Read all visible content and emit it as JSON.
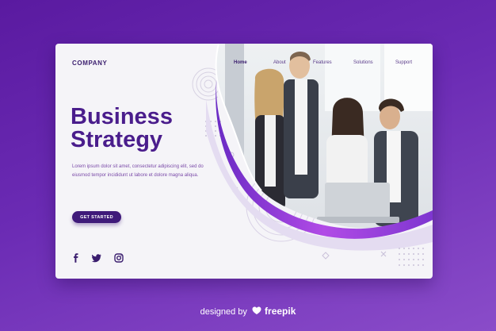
{
  "header": {
    "brand": "COMPANY",
    "nav": [
      {
        "label": "Home",
        "active": true
      },
      {
        "label": "About",
        "active": false
      },
      {
        "label": "Features",
        "active": false
      },
      {
        "label": "Solutions",
        "active": false
      },
      {
        "label": "Support",
        "active": false
      }
    ]
  },
  "hero": {
    "title_line1": "Business",
    "title_line2": "Strategy",
    "body": "Lorem ipsum dolor sit amet, consectetur adipiscing elit, sed do eiusmod tempor incididunt ut labore et dolore magna aliqua.",
    "cta_label": "GET STARTED"
  },
  "social": [
    "facebook-icon",
    "twitter-icon",
    "instagram-icon"
  ],
  "footer": {
    "designed_by": "designed by",
    "brand": "freepik"
  },
  "colors": {
    "background_top": "#5a1aa0",
    "background_bottom": "#8a4cc9",
    "accent": "#4a1d8c",
    "card": "#f5f4f8",
    "wave": "#9b3fe0"
  }
}
